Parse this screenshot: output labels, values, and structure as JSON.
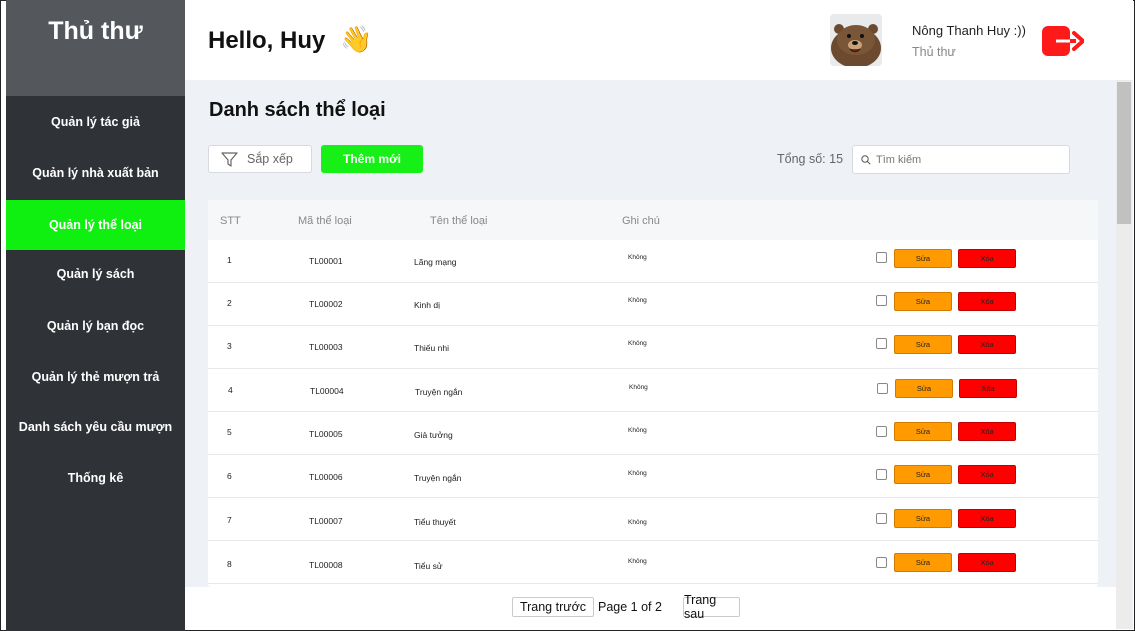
{
  "sidebar": {
    "brand": "Thủ thư",
    "items": [
      {
        "label": "Quản lý tác giả"
      },
      {
        "label": "Quản lý nhà xuất bản"
      },
      {
        "label": "Quản lý thể loại",
        "active": true
      },
      {
        "label": "Quản lý sách"
      },
      {
        "label": "Quản lý bạn đọc"
      },
      {
        "label": "Quản lý thẻ mượn trả"
      },
      {
        "label": "Danh sách yêu cầu mượn"
      },
      {
        "label": "Thống kê"
      }
    ]
  },
  "header": {
    "greeting": "Hello, Huy",
    "wave": "👋",
    "user_name": "Nông Thanh Huy :))",
    "user_role": "Thủ thư"
  },
  "page": {
    "title": "Danh sách thể loại",
    "sort_label": "Sắp xếp",
    "add_label": "Thêm mới",
    "total": "Tổng số: 15",
    "search_placeholder": "Tìm kiếm"
  },
  "table": {
    "headers": {
      "stt": "STT",
      "code": "Mã thể loại",
      "name": "Tên thể loại",
      "note": "Ghi chú"
    },
    "edit_label": "Sửa",
    "delete_label": "Xóa",
    "rows": [
      {
        "stt": "1",
        "code": "TL00001",
        "name": "Lãng mạng",
        "note": "Không"
      },
      {
        "stt": "2",
        "code": "TL00002",
        "name": "Kinh dị",
        "note": "Không"
      },
      {
        "stt": "3",
        "code": "TL00003",
        "name": "Thiếu nhi",
        "note": "Không"
      },
      {
        "stt": "4",
        "code": "TL00004",
        "name": "Truyện ngắn",
        "note": "Không"
      },
      {
        "stt": "5",
        "code": "TL00005",
        "name": "Giả tưởng",
        "note": "Không"
      },
      {
        "stt": "6",
        "code": "TL00006",
        "name": "Truyện ngắn",
        "note": "Không"
      },
      {
        "stt": "7",
        "code": "TL00007",
        "name": "Tiểu thuyết",
        "note": "Không"
      },
      {
        "stt": "8",
        "code": "TL00008",
        "name": "Tiểu sử",
        "note": "Không"
      }
    ]
  },
  "pagination": {
    "prev_label": "Trang trước",
    "page_info": "Page 1 of 2",
    "next_label": "Trang sau"
  },
  "colors": {
    "active_nav": "#10f010",
    "add_button": "#16f016",
    "edit_button": "#ff9a00",
    "delete_button": "#ff0000",
    "logout_icon": "#ff1a1a"
  }
}
